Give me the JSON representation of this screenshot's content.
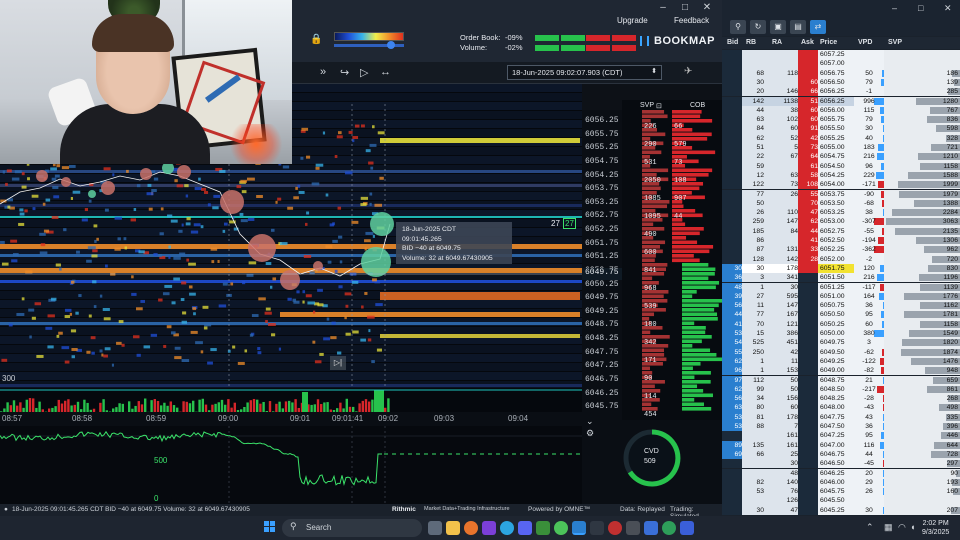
{
  "app": {
    "brand": "BOOKMAP",
    "upgrade": "Upgrade",
    "feedback": "Feedback",
    "order_book_label": "Order Book:",
    "order_book_value": "-09%",
    "volume_label": "Volume:",
    "volume_value": "-02%",
    "datetime": "18-Jun-2025 09:02:07.903 (CDT)"
  },
  "tooltip": {
    "line1": "18-Jun-2025 CDT",
    "line2": "09:01:45.265",
    "line3": "BID −40 at 6049.75",
    "line4": "Volume: 32 at 6049.67430905"
  },
  "price_axis": {
    "labels": [
      "6056.25",
      "6055.75",
      "6055.25",
      "6054.75",
      "6054.25",
      "6053.75",
      "6053.25",
      "6052.75",
      "6052.25",
      "6051.75",
      "6051.25",
      "6050.75",
      "6050.25",
      "6049.75",
      "6049.25",
      "6048.75",
      "6048.25",
      "6047.75",
      "6047.25",
      "6046.75",
      "6046.25",
      "6045.75",
      "6045.25",
      "6044.75"
    ],
    "svp_overlay": [
      "226",
      "290",
      "531",
      "2050",
      "1085",
      "1095",
      "490",
      "600",
      "841",
      "968",
      "539",
      "180",
      "342",
      "171",
      "90",
      "114",
      "454"
    ],
    "current_price": "6049.75",
    "marker_label": "27",
    "marker_badge": "27"
  },
  "svp_cob": {
    "svp_header": "SVP",
    "cob_header": "COB",
    "cob_values": [
      "66",
      "579",
      "73",
      "108",
      "907",
      "44"
    ]
  },
  "time_axis": {
    "labels": [
      "08:57",
      "08:58",
      "08:59",
      "09:00",
      "09:01",
      "09:01:41",
      "09:02",
      "09:03",
      "09:04"
    ]
  },
  "heatmap": {
    "left_value": "300",
    "cvd_mid": "500",
    "cvd_zero": "0"
  },
  "cvd": {
    "label": "CVD",
    "value": "509"
  },
  "status": {
    "left": "18-Jun-2025 09:01:45.265 CDT     BID −40 at 6049.75   Volume: 32 at 6049.67430905",
    "rithmic": "Rithmic",
    "rithmic_sub": "Market Data+Trading Infrastructure",
    "powered": "Powered by OMNE™",
    "data": "Data: Replayed",
    "trading": "Trading: Simulated"
  },
  "ladder": {
    "headers": {
      "bid": "Bid",
      "rb": "RB",
      "ra": "RA",
      "ask": "Ask",
      "price": "Price",
      "vpd": "VPD",
      "svp": "SVP"
    },
    "rows": [
      {
        "bid": "",
        "rb": "",
        "ra": "",
        "ask": "",
        "price": "6057.25",
        "vpd": "",
        "svp": "",
        "svpw": 0
      },
      {
        "bid": "",
        "rb": "",
        "ra": "",
        "ask": "",
        "price": "6057.00",
        "vpd": "",
        "svp": "",
        "svpw": 0
      },
      {
        "bid": "",
        "rb": "68",
        "ra": "118",
        "ask": "",
        "price": "6056.75",
        "vpd": "50",
        "svp": "186",
        "svpw": 8
      },
      {
        "bid": "",
        "rb": "30",
        "ra": "",
        "ask": "60",
        "price": "6056.50",
        "vpd": "79",
        "svp": "139",
        "svpw": 6
      },
      {
        "bid": "",
        "rb": "20",
        "ra": "146",
        "ask": "66",
        "price": "6056.25",
        "vpd": "-1",
        "svp": "285",
        "svpw": 12
      },
      {
        "bid": "",
        "rb": "142",
        "ra": "1138",
        "ask": "51",
        "price": "6056.25",
        "vpd": "996",
        "svp": "1280",
        "svpw": 44,
        "hl": true
      },
      {
        "bid": "",
        "rb": "44",
        "ra": "38",
        "ask": "60",
        "price": "6056.00",
        "vpd": "115",
        "svp": "767",
        "svpw": 30
      },
      {
        "bid": "",
        "rb": "63",
        "ra": "102",
        "ask": "60",
        "price": "6055.75",
        "vpd": "79",
        "svp": "836",
        "svpw": 33
      },
      {
        "bid": "",
        "rb": "84",
        "ra": "60",
        "ask": "91",
        "price": "6055.50",
        "vpd": "30",
        "svp": "598",
        "svpw": 24
      },
      {
        "bid": "",
        "rb": "62",
        "ra": "52",
        "ask": "42",
        "price": "6055.25",
        "vpd": "40",
        "svp": "328",
        "svpw": 14
      },
      {
        "bid": "",
        "rb": "51",
        "ra": "5",
        "ask": "73",
        "price": "6055.00",
        "vpd": "183",
        "svp": "721",
        "svpw": 29
      },
      {
        "bid": "",
        "rb": "22",
        "ra": "67",
        "ask": "64",
        "price": "6054.75",
        "vpd": "216",
        "svp": "1210",
        "svpw": 42
      },
      {
        "bid": "",
        "rb": "59",
        "ra": "",
        "ask": "61",
        "price": "6054.50",
        "vpd": "96",
        "svp": "1158",
        "svpw": 40
      },
      {
        "bid": "",
        "rb": "12",
        "ra": "63",
        "ask": "58",
        "price": "6054.25",
        "vpd": "229",
        "svp": "1588",
        "svpw": 52
      },
      {
        "bid": "",
        "rb": "122",
        "ra": "73",
        "ask": "108",
        "price": "6054.00",
        "vpd": "-171",
        "svp": "1999",
        "svpw": 62
      },
      {
        "bid": "",
        "rb": "77",
        "ra": "26",
        "ask": "55",
        "price": "6053.75",
        "vpd": "-90",
        "svp": "1979",
        "svpw": 61
      },
      {
        "bid": "",
        "rb": "50",
        "ra": "",
        "ask": "70",
        "price": "6053.50",
        "vpd": "-68",
        "svp": "1388",
        "svpw": 46
      },
      {
        "bid": "",
        "rb": "26",
        "ra": "110",
        "ask": "47",
        "price": "6053.25",
        "vpd": "38",
        "svp": "2284",
        "svpw": 68
      },
      {
        "bid": "",
        "rb": "259",
        "ra": "147",
        "ask": "62",
        "price": "6053.00",
        "vpd": "-307",
        "svp": "3063",
        "svpw": 74
      },
      {
        "bid": "",
        "rb": "185",
        "ra": "84",
        "ask": "44",
        "price": "6052.75",
        "vpd": "-55",
        "svp": "2135",
        "svpw": 65
      },
      {
        "bid": "",
        "rb": "86",
        "ra": "",
        "ask": "41",
        "price": "6052.50",
        "vpd": "-194",
        "svp": "1306",
        "svpw": 44
      },
      {
        "bid": "",
        "rb": "87",
        "ra": "131",
        "ask": "33",
        "price": "6052.25",
        "vpd": "-362",
        "svp": "962",
        "svpw": 36
      },
      {
        "bid": "",
        "rb": "128",
        "ra": "142",
        "ask": "28",
        "price": "6052.00",
        "vpd": "-2",
        "svp": "720",
        "svpw": 28
      },
      {
        "bid": "30",
        "rb": "30",
        "ra": "178",
        "ask": "",
        "price": "6051.75",
        "vpd": "120",
        "svp": "830",
        "svpw": 32,
        "cur": true
      },
      {
        "bid": "36",
        "rb": "3",
        "ra": "341",
        "ask": "",
        "price": "6051.50",
        "vpd": "216",
        "svp": "1196",
        "svpw": 41
      },
      {
        "bid": "48",
        "rb": "1",
        "ra": "30",
        "ask": "",
        "price": "6051.25",
        "vpd": "-117",
        "svp": "1139",
        "svpw": 40
      },
      {
        "bid": "39",
        "rb": "27",
        "ra": "595",
        "ask": "",
        "price": "6051.00",
        "vpd": "164",
        "svp": "1776",
        "svpw": 56
      },
      {
        "bid": "56",
        "rb": "11",
        "ra": "147",
        "ask": "",
        "price": "6050.75",
        "vpd": "36",
        "svp": "1162",
        "svpw": 40
      },
      {
        "bid": "44",
        "rb": "77",
        "ra": "167",
        "ask": "",
        "price": "6050.50",
        "vpd": "95",
        "svp": "1781",
        "svpw": 56
      },
      {
        "bid": "41",
        "rb": "70",
        "ra": "121",
        "ask": "",
        "price": "6050.25",
        "vpd": "60",
        "svp": "1158",
        "svpw": 40
      },
      {
        "bid": "53",
        "rb": "15",
        "ra": "386",
        "ask": "",
        "price": "6050.00",
        "vpd": "380",
        "svp": "1549",
        "svpw": 51
      },
      {
        "bid": "54",
        "rb": "525",
        "ra": "451",
        "ask": "",
        "price": "6049.75",
        "vpd": "3",
        "svp": "1820",
        "svpw": 58
      },
      {
        "bid": "55",
        "rb": "250",
        "ra": "42",
        "ask": "",
        "price": "6049.50",
        "vpd": "-62",
        "svp": "1874",
        "svpw": 59
      },
      {
        "bid": "62",
        "rb": "1",
        "ra": "11",
        "ask": "",
        "price": "6049.25",
        "vpd": "-122",
        "svp": "1476",
        "svpw": 49
      },
      {
        "bid": "96",
        "rb": "1",
        "ra": "153",
        "ask": "",
        "price": "6049.00",
        "vpd": "-82",
        "svp": "948",
        "svpw": 35
      },
      {
        "bid": "97",
        "rb": "112",
        "ra": "50",
        "ask": "",
        "price": "6048.75",
        "vpd": "21",
        "svp": "659",
        "svpw": 27
      },
      {
        "bid": "62",
        "rb": "99",
        "ra": "50",
        "ask": "",
        "price": "6048.50",
        "vpd": "-217",
        "svp": "861",
        "svpw": 33
      },
      {
        "bid": "56",
        "rb": "34",
        "ra": "156",
        "ask": "",
        "price": "6048.25",
        "vpd": "-28",
        "svp": "268",
        "svpw": 12
      },
      {
        "bid": "63",
        "rb": "80",
        "ra": "60",
        "ask": "",
        "price": "6048.00",
        "vpd": "-43",
        "svp": "498",
        "svpw": 21
      },
      {
        "bid": "53",
        "rb": "81",
        "ra": "178",
        "ask": "",
        "price": "6047.75",
        "vpd": "43",
        "svp": "335",
        "svpw": 14
      },
      {
        "bid": "53",
        "rb": "88",
        "ra": "7",
        "ask": "",
        "price": "6047.50",
        "vpd": "36",
        "svp": "396",
        "svpw": 17
      },
      {
        "bid": "",
        "rb": "",
        "ra": "161",
        "ask": "",
        "price": "6047.25",
        "vpd": "95",
        "svp": "446",
        "svpw": 19
      },
      {
        "bid": "89",
        "rb": "135",
        "ra": "161",
        "ask": "",
        "price": "6047.00",
        "vpd": "116",
        "svp": "644",
        "svpw": 26
      },
      {
        "bid": "69",
        "rb": "66",
        "ra": "25",
        "ask": "",
        "price": "6046.75",
        "vpd": "44",
        "svp": "728",
        "svpw": 29
      },
      {
        "bid": "",
        "rb": "",
        "ra": "30",
        "ask": "",
        "price": "6046.50",
        "vpd": "-45",
        "svp": "297",
        "svpw": 13
      },
      {
        "bid": "",
        "rb": "",
        "ra": "48",
        "ask": "",
        "price": "6046.25",
        "vpd": "20",
        "svp": "90",
        "svpw": 4
      },
      {
        "bid": "",
        "rb": "82",
        "ra": "140",
        "ask": "",
        "price": "6046.00",
        "vpd": "29",
        "svp": "193",
        "svpw": 8
      },
      {
        "bid": "",
        "rb": "53",
        "ra": "76",
        "ask": "",
        "price": "6045.75",
        "vpd": "26",
        "svp": "160",
        "svpw": 7
      },
      {
        "bid": "",
        "rb": "",
        "ra": "126",
        "ask": "",
        "price": "6045.50",
        "vpd": "",
        "svp": "",
        "svpw": 0
      },
      {
        "bid": "",
        "rb": "30",
        "ra": "47",
        "ask": "",
        "price": "6045.25",
        "vpd": "30",
        "svp": "207",
        "svpw": 9
      },
      {
        "bid": "",
        "rb": "32",
        "ra": "75",
        "ask": "",
        "price": "6045.00",
        "vpd": "101",
        "svp": "347",
        "svpw": 15
      },
      {
        "bid": "",
        "rb": "41",
        "ra": "58",
        "ask": "",
        "price": "6044.75",
        "vpd": "165",
        "svp": "615",
        "svpw": 25
      },
      {
        "bid": "",
        "rb": "",
        "ra": "84",
        "ask": "",
        "price": "6044.50",
        "vpd": "",
        "svp": "",
        "svpw": 0
      }
    ]
  },
  "taskbar": {
    "search_placeholder": "Search",
    "time": "2:02 PM",
    "date": "9/3/2025"
  },
  "colors": {
    "bid": "#2a7fcf",
    "ask": "#d6262b",
    "cvd_line": "#3be36a",
    "accent": "#3aa5ff"
  }
}
